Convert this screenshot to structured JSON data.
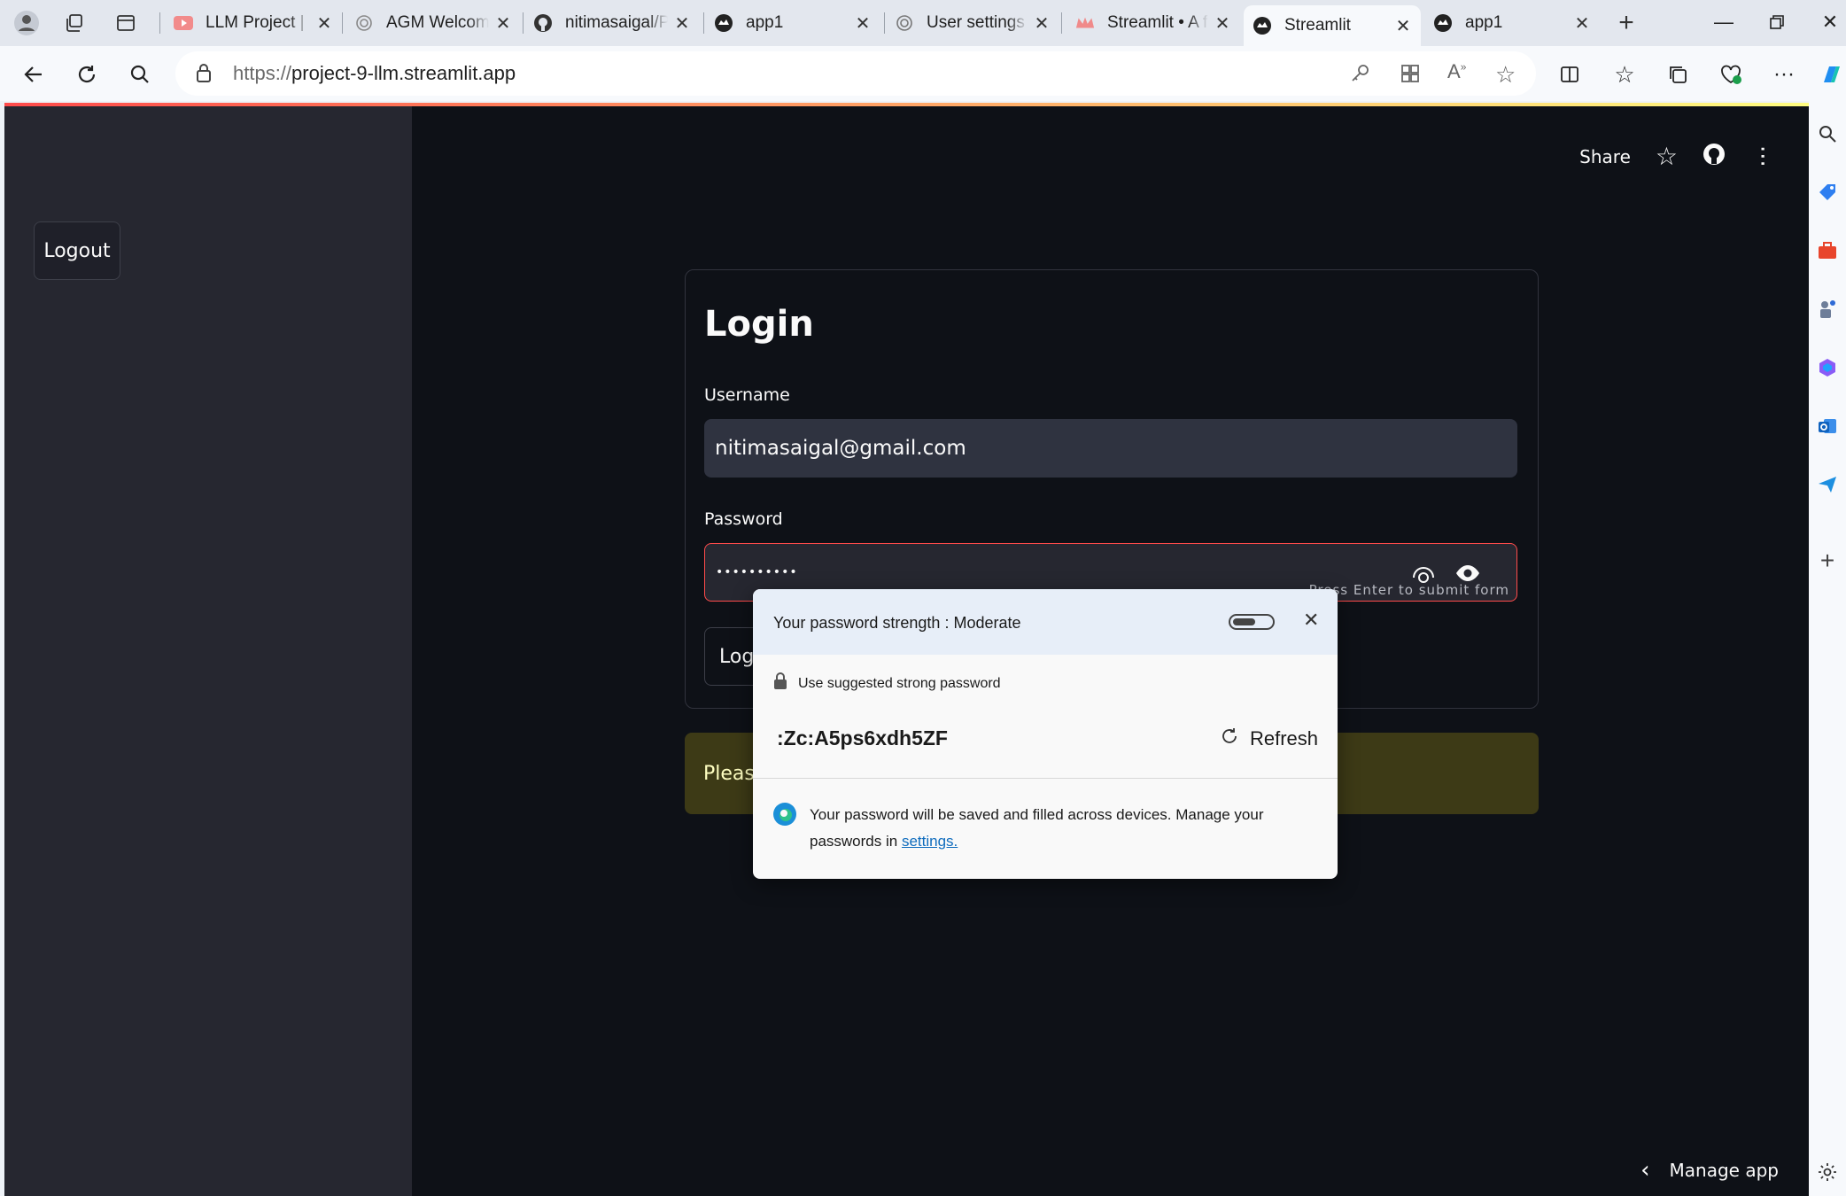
{
  "browser": {
    "tabs": [
      {
        "title": "LLM Project | En",
        "icon": "youtube-icon"
      },
      {
        "title": "AGM Welcome",
        "icon": "openai-icon"
      },
      {
        "title": "nitimasaigal/Pro",
        "icon": "github-icon"
      },
      {
        "title": "app1",
        "icon": "streamlit-icon"
      },
      {
        "title": "User settings -",
        "icon": "openai-icon"
      },
      {
        "title": "Streamlit • A fa",
        "icon": "streamlit-crown-icon"
      },
      {
        "title": "Streamlit",
        "icon": "streamlit-icon",
        "active": true
      },
      {
        "title": "app1",
        "icon": "streamlit-icon"
      }
    ],
    "url_protocol": "https://",
    "url_host": "project-9-llm.streamlit.app"
  },
  "app": {
    "sidebar": {
      "logout_label": "Logout"
    },
    "header": {
      "share_label": "Share"
    },
    "form": {
      "title": "Login",
      "username_label": "Username",
      "username_value": "nitimasaigal@gmail.com",
      "password_label": "Password",
      "password_masked": "••••••••••",
      "password_hint": "Press Enter to submit form",
      "login_label": "Logi"
    },
    "warning_text": "Please",
    "manage_app_label": "Manage app"
  },
  "password_popup": {
    "strength_text": "Your password strength :  Moderate",
    "strength_level": 0.6,
    "suggest_text": "Use suggested strong password",
    "suggested_password": ":Zc:A5ps6xdh5ZF",
    "refresh_label": "Refresh",
    "footer_text": "Your password will be saved and filled across devices. Manage your passwords in",
    "settings_link": "settings."
  },
  "colors": {
    "accent_red": "#ff4b4b",
    "page_bg": "#0e1117",
    "sidebar_bg": "#262730",
    "warning_bg": "#3d3a16",
    "link": "#0f6cbd"
  }
}
